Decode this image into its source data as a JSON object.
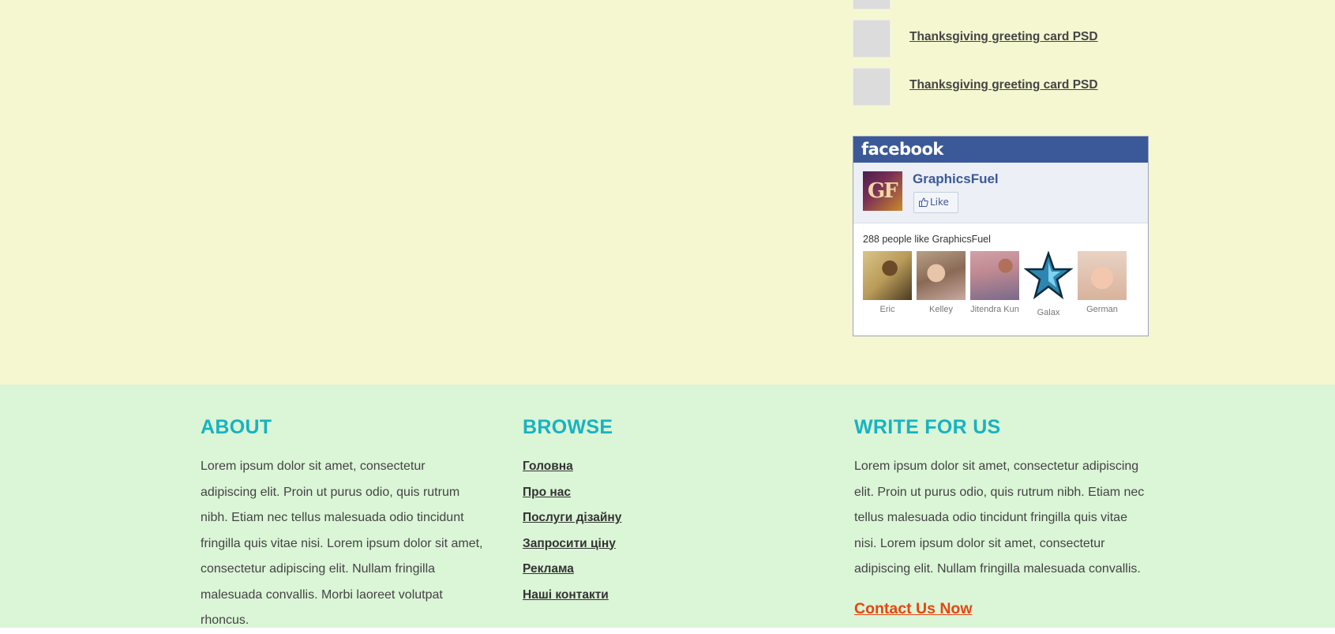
{
  "related": {
    "items": [
      {
        "label": "Thanksgiving greeting card PSD"
      },
      {
        "label": "Thanksgiving greeting card PSD"
      }
    ]
  },
  "facebook": {
    "brand": "facebook",
    "page_name": "GraphicsFuel",
    "logo_text": "GF",
    "like_label": "Like",
    "fan_count_text": "288 people like GraphicsFuel",
    "fans": [
      {
        "name": "Eric"
      },
      {
        "name": "Kelley"
      },
      {
        "name": "Jitendra Kun"
      },
      {
        "name": "Galax"
      },
      {
        "name": "German"
      }
    ]
  },
  "footer": {
    "about": {
      "title": "ABOUT",
      "text": "Lorem ipsum dolor sit amet, consectetur adipiscing elit. Proin ut purus odio, quis rutrum nibh. Etiam nec tellus malesuada odio tincidunt fringilla quis vitae nisi. Lorem ipsum dolor sit amet, consectetur adipiscing elit. Nullam fringilla malesuada convallis. Morbi laoreet volutpat rhoncus."
    },
    "browse": {
      "title": "BROWSE",
      "links": [
        {
          "label": "Головна"
        },
        {
          "label": "Про нас"
        },
        {
          "label": "Послуги дізайну"
        },
        {
          "label": "Запросити ціну"
        },
        {
          "label": "Реклама"
        },
        {
          "label": "Наші контакти"
        }
      ]
    },
    "write": {
      "title": "WRITE FOR US",
      "text": "Lorem ipsum dolor sit amet, consectetur adipiscing elit. Proin ut purus odio, quis rutrum nibh. Etiam nec tellus malesuada odio tincidunt fringilla quis vitae nisi. Lorem ipsum dolor sit amet, consectetur adipiscing elit. Nullam fringilla malesuada convallis.",
      "contact_label": "Contact Us Now"
    }
  },
  "colors": {
    "top_background": "#f5f7d1",
    "footer_background": "#dbf5d7",
    "heading_accent": "#17b3c1",
    "contact_link": "#e8450f",
    "facebook_blue": "#3b5998"
  }
}
